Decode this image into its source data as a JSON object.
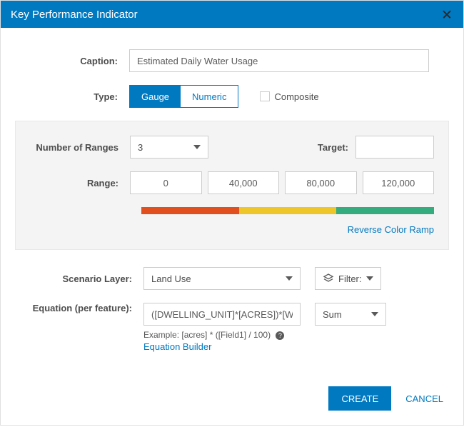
{
  "dialog": {
    "title": "Key Performance Indicator"
  },
  "caption": {
    "label": "Caption:",
    "value": "Estimated Daily Water Usage"
  },
  "type": {
    "label": "Type:",
    "gauge": "Gauge",
    "numeric": "Numeric",
    "composite": "Composite",
    "selected": "Gauge"
  },
  "gauge": {
    "numRangesLabel": "Number of Ranges",
    "numRanges": "3",
    "targetLabel": "Target:",
    "targetValue": "",
    "rangeLabel": "Range:",
    "rangeValues": [
      "0",
      "40,000",
      "80,000",
      "120,000"
    ],
    "rampColors": [
      "#e04f1d",
      "#efc62a",
      "#35ac7e"
    ],
    "reverseLabel": "Reverse Color Ramp"
  },
  "scenario": {
    "label": "Scenario Layer:",
    "value": "Land Use",
    "filter": "Filter:"
  },
  "equation": {
    "label": "Equation (per feature):",
    "value": "([DWELLING_UNIT]*[ACRES])*[WATER",
    "agg": "Sum",
    "example": "Example: [acres] * ([Field1] / 100)",
    "builder": "Equation Builder"
  },
  "buttons": {
    "create": "CREATE",
    "cancel": "CANCEL"
  }
}
